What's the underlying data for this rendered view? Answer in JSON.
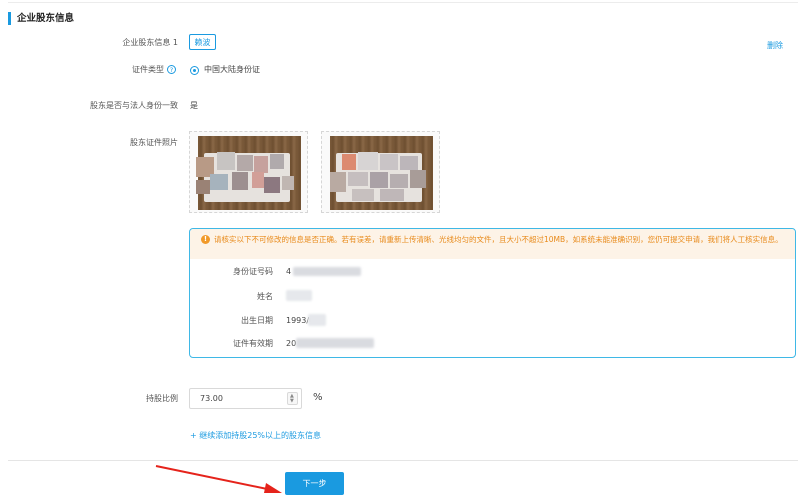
{
  "section": {
    "title": "企业股东信息"
  },
  "shareholder": {
    "label": "企业股东信息 1",
    "name_tag": "赖波",
    "delete_label": "删除"
  },
  "cert_type": {
    "label": "证件类型",
    "help_icon": "question-icon",
    "option_label": "中国大陆身份证",
    "selected": true
  },
  "legal_same": {
    "label": "股东是否与法人身份一致",
    "value": "是"
  },
  "photos": {
    "label": "股东证件照片"
  },
  "notice": {
    "icon": "warning-icon",
    "text": "请核实以下不可修改的信息是否正确。若有误差，请重新上传清晰、光线均匀的文件，且大小不超过10MB，如系统未能准确识别，您仍可提交申请，我们将人工核实信息。",
    "fields": [
      {
        "label": "身份证号码",
        "value": "4"
      },
      {
        "label": "姓名",
        "value": ""
      },
      {
        "label": "出生日期",
        "value": "1993/0"
      },
      {
        "label": "证件有效期",
        "value": "20"
      }
    ]
  },
  "ratio": {
    "label": "持股比例",
    "value": "73.00",
    "unit": "%"
  },
  "add_more": {
    "label": "+ 继续添加持股25%以上的股东信息"
  },
  "next_button": {
    "label": "下一步"
  },
  "colors": {
    "accent": "#1a9ae0",
    "warning": "#e88a1a",
    "annotation_arrow": "#e5231b"
  }
}
